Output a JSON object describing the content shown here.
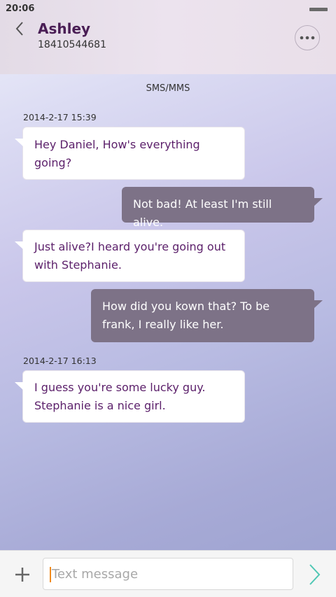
{
  "status_bar": {
    "time": "20:06"
  },
  "header": {
    "contact_name": "Ashley",
    "contact_number": "18410544681"
  },
  "conversation": {
    "channel_label": "SMS/MMS",
    "timestamps": [
      "2014-2-17 15:39",
      "2014-2-17 16:13"
    ],
    "messages": [
      {
        "direction": "incoming",
        "lines": [
          "Hey Daniel, How's everything",
          "going?"
        ]
      },
      {
        "direction": "outgoing",
        "lines": [
          "Not bad! At least I'm still alive."
        ]
      },
      {
        "direction": "incoming",
        "lines": [
          "Just  alive?I heard you're going out",
          "with Stephanie."
        ]
      },
      {
        "direction": "outgoing",
        "lines": [
          "How did you kown that? To be",
          "frank, I really like her."
        ]
      },
      {
        "direction": "incoming",
        "lines": [
          "I guess you're some lucky guy.",
          "Stephanie is a nice girl."
        ]
      }
    ]
  },
  "composer": {
    "placeholder": "Text message"
  },
  "icons": {
    "back": "chevron-left-icon",
    "more": "more-dots-icon",
    "add": "plus-icon",
    "send": "chevron-right-icon"
  },
  "colors": {
    "incoming_text": "#5b1f6a",
    "outgoing_bubble": "#7d7287",
    "send_accent": "#4fc7b4"
  }
}
